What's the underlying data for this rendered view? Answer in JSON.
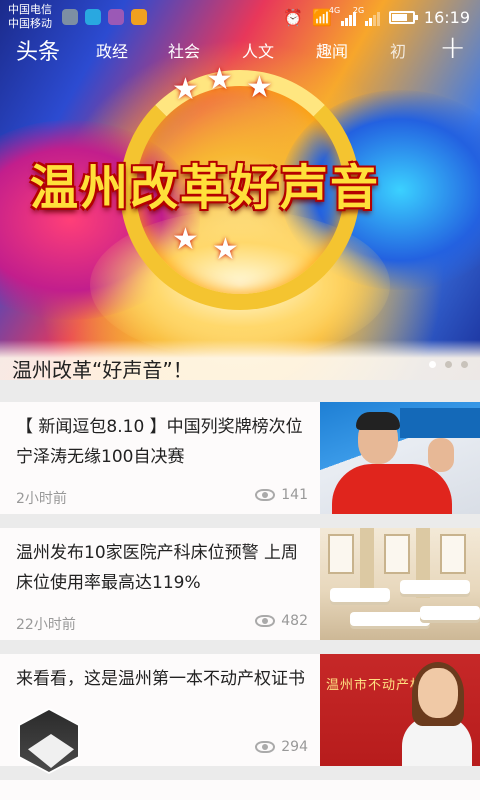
{
  "status_bar": {
    "carrier_1": "中国电信",
    "carrier_2": "中国移动",
    "net_1": "4G",
    "net_2": "2G",
    "time": "16:19"
  },
  "nav": {
    "main_label": "头条",
    "tabs": [
      "政经",
      "社会",
      "人文",
      "趣闻",
      "初"
    ],
    "add_label": "+"
  },
  "hero": {
    "banner_title": "温州改革好声音",
    "caption": "温州改革“好声音”！",
    "page_count": 3,
    "active_page": 1
  },
  "feed": {
    "items": [
      {
        "title": "【 新闻逗包8.10 】中国列奖牌榜次位 宁泽涛无缘100自决赛",
        "time": "2小时前",
        "views": "141",
        "thumb": "swimmer-photo"
      },
      {
        "title": "温州发布10家医院产科床位预警 上周床位使用率最高达119%",
        "time": "22小时前",
        "views": "482",
        "thumb": "hospital-ward-photo"
      },
      {
        "title": "来看看，这是温州第一本不动产权证书",
        "time": "",
        "views": "294",
        "thumb": "certificate-photo",
        "thumb_text": "温州市不动产权证书"
      }
    ]
  }
}
